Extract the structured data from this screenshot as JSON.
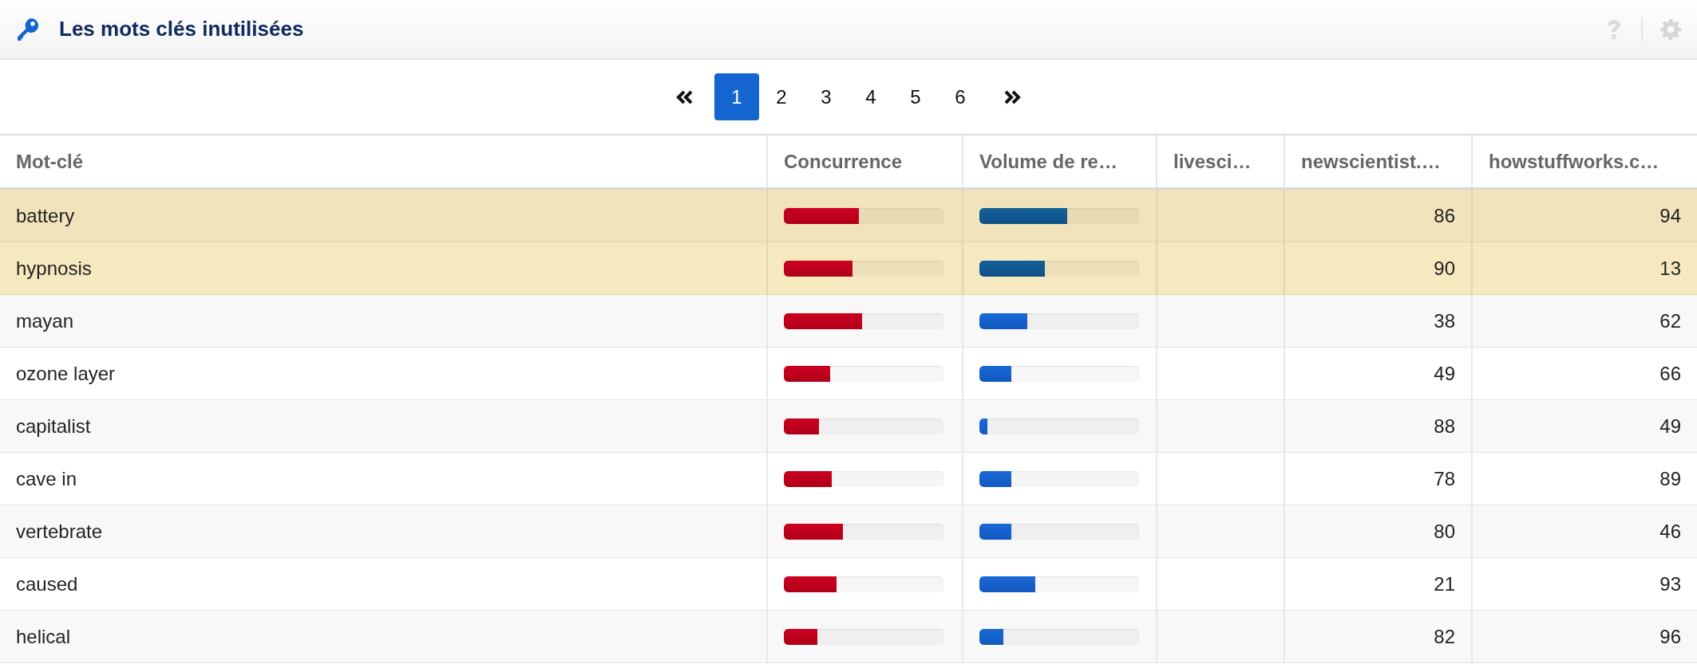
{
  "panel": {
    "title": "Les mots clés inutilisées"
  },
  "pagination": {
    "pages": [
      {
        "label": "1",
        "selected": true
      },
      {
        "label": "2",
        "selected": false
      },
      {
        "label": "3",
        "selected": false
      },
      {
        "label": "4",
        "selected": false
      },
      {
        "label": "5",
        "selected": false
      },
      {
        "label": "6",
        "selected": false
      }
    ]
  },
  "table": {
    "columns": [
      {
        "label": "Mot-clé",
        "kind": "text"
      },
      {
        "label": "Concurrence",
        "kind": "bar"
      },
      {
        "label": "Volume de re…",
        "kind": "bar"
      },
      {
        "label": "livesci…",
        "kind": "number"
      },
      {
        "label": "newscientist.…",
        "kind": "number"
      },
      {
        "label": "howstuffworks.c…",
        "kind": "number"
      }
    ],
    "rows": [
      {
        "highlighted": true,
        "hovered": true,
        "cells": [
          "battery",
          {
            "level": 0.47
          },
          {
            "level": 0.55
          },
          "",
          "86",
          "94"
        ]
      },
      {
        "highlighted": true,
        "hovered": false,
        "cells": [
          "hypnosis",
          {
            "level": 0.43
          },
          {
            "level": 0.41
          },
          "",
          "90",
          "13"
        ]
      },
      {
        "highlighted": false,
        "hovered": false,
        "cells": [
          "mayan",
          {
            "level": 0.49
          },
          {
            "level": 0.3
          },
          "",
          "38",
          "62"
        ]
      },
      {
        "highlighted": false,
        "hovered": false,
        "cells": [
          "ozone layer",
          {
            "level": 0.29
          },
          {
            "level": 0.2
          },
          "",
          "49",
          "66"
        ]
      },
      {
        "highlighted": false,
        "hovered": false,
        "cells": [
          "capitalist",
          {
            "level": 0.22
          },
          {
            "level": 0.05
          },
          "",
          "88",
          "49"
        ]
      },
      {
        "highlighted": false,
        "hovered": false,
        "cells": [
          "cave in",
          {
            "level": 0.3
          },
          {
            "level": 0.2
          },
          "",
          "78",
          "89"
        ]
      },
      {
        "highlighted": false,
        "hovered": false,
        "cells": [
          "vertebrate",
          {
            "level": 0.37
          },
          {
            "level": 0.2
          },
          "",
          "80",
          "46"
        ]
      },
      {
        "highlighted": false,
        "hovered": false,
        "cells": [
          "caused",
          {
            "level": 0.33
          },
          {
            "level": 0.35
          },
          "",
          "21",
          "93"
        ]
      },
      {
        "highlighted": false,
        "hovered": false,
        "cells": [
          "helical",
          {
            "level": 0.21
          },
          {
            "level": 0.15
          },
          "",
          "82",
          "96"
        ]
      }
    ]
  }
}
